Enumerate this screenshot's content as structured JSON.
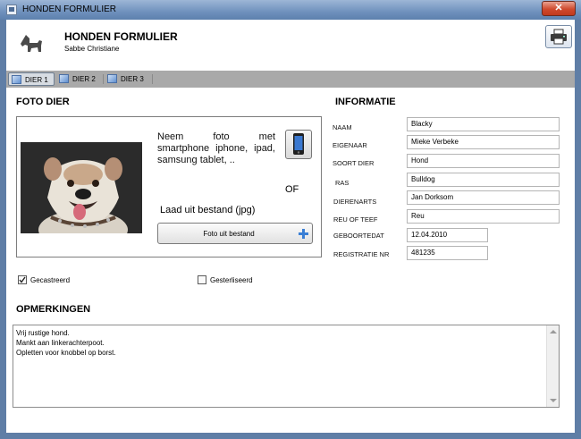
{
  "window": {
    "title": "HONDEN FORMULIER",
    "close_glyph": "✕"
  },
  "header": {
    "title": "HONDEN FORMULIER",
    "subtitle": "Sabbe Christiane",
    "logo_icon": "dog-icon",
    "print_icon": "printer-icon"
  },
  "tabs": [
    {
      "label": "DIER 1",
      "active": true
    },
    {
      "label": "DIER 2",
      "active": false
    },
    {
      "label": "DIER 3",
      "active": false
    }
  ],
  "photo_section": {
    "heading": "FOTO DIER",
    "smartphone_text": "Neem foto met smartphone iphone, ipad, samsung tablet, ..",
    "or_label": "OF",
    "load_label": "Laad uit bestand (jpg)",
    "upload_button": "Foto uit bestand"
  },
  "checkboxes": [
    {
      "label": "Gecastreerd",
      "checked": true
    },
    {
      "label": "Gesterliseerd",
      "checked": false
    }
  ],
  "info_section": {
    "heading": "INFORMATIE",
    "fields": [
      {
        "label": "NAAM",
        "value": "Blacky"
      },
      {
        "label": "EIGENAAR",
        "value": "Mieke Verbeke"
      },
      {
        "label": "SOORT DIER",
        "value": "Hond"
      },
      {
        "label": "RAS",
        "value": "Bulldog"
      },
      {
        "label": "DIERENARTS",
        "value": "Jan Dorksom"
      },
      {
        "label": "REU OF TEEF",
        "value": "Reu"
      },
      {
        "label": "GEBOORTEDAT",
        "value": "12.04.2010"
      },
      {
        "label": "REGISTRATIE NR",
        "value": "481235"
      }
    ]
  },
  "remarks": {
    "heading": "OPMERKINGEN",
    "lines": [
      "Vrij rustige hond.",
      "Mankt aan linkerachterpoot.",
      "Opletten voor knobbel op borst."
    ]
  },
  "colors": {
    "titlebar": "#6f91bd",
    "tabbar": "#a9a9a9",
    "close": "#cf4a2e"
  }
}
